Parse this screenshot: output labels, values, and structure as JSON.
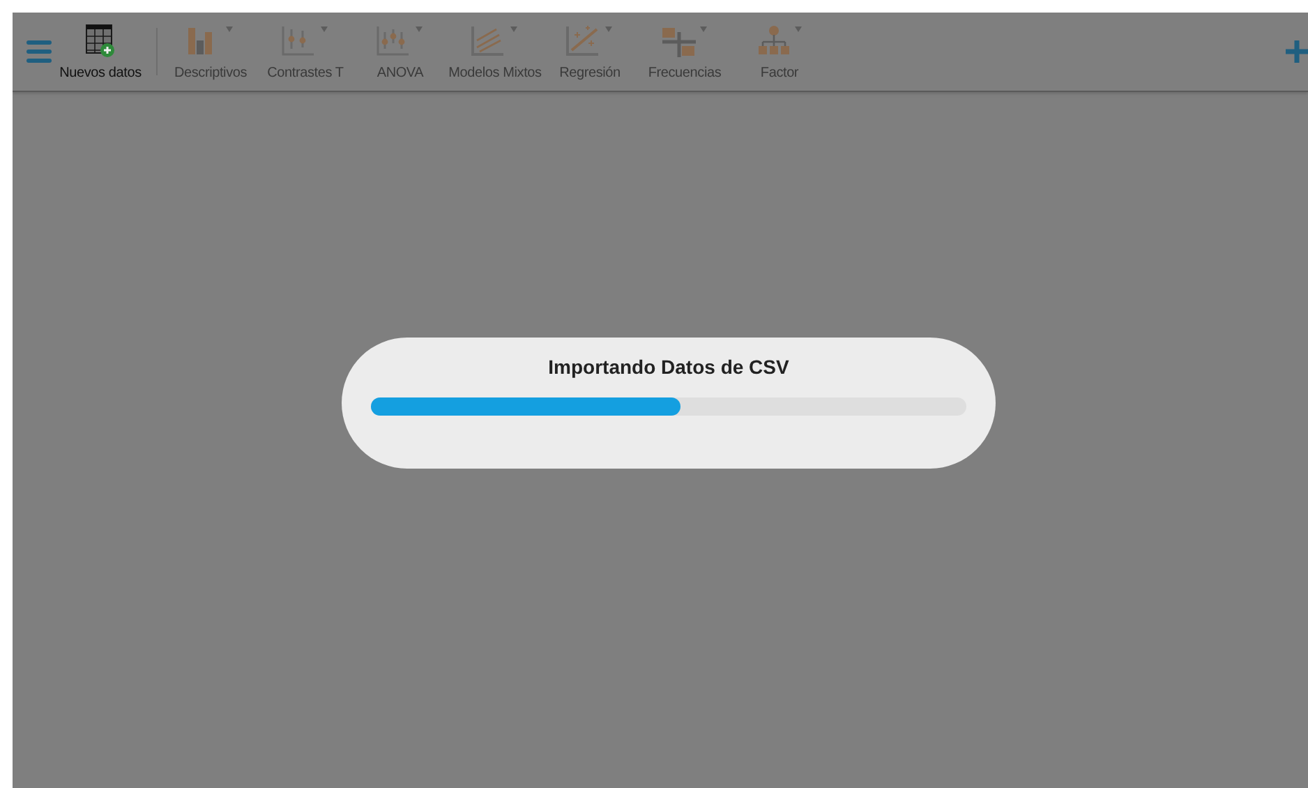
{
  "toolbar": {
    "data_button": {
      "label": "Nuevos datos",
      "disabled": false
    },
    "analyses": [
      {
        "kind": "descriptives",
        "label": "Descriptivos",
        "disabled": true
      },
      {
        "kind": "ttest",
        "label": "Contrastes T",
        "disabled": true
      },
      {
        "kind": "anova",
        "label": "ANOVA",
        "disabled": true
      },
      {
        "kind": "mixed",
        "label": "Modelos Mixtos",
        "disabled": true
      },
      {
        "kind": "regression",
        "label": "Regresión",
        "disabled": true
      },
      {
        "kind": "frequencies",
        "label": "Frecuencias",
        "disabled": true
      },
      {
        "kind": "factor",
        "label": "Factor",
        "disabled": true
      }
    ]
  },
  "progress_dialog": {
    "title": "Importando Datos de CSV",
    "level": 0.52
  }
}
